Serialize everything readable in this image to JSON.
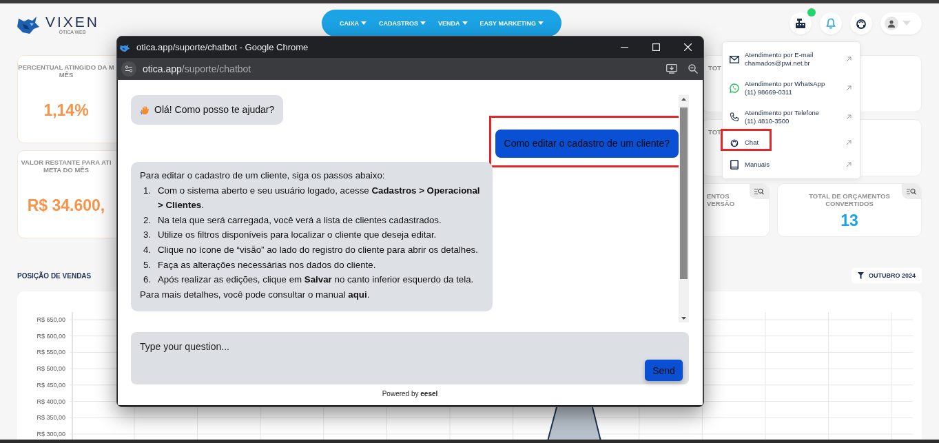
{
  "logo": {
    "name": "VIXEN",
    "subtitle": "ÓTICA WEB"
  },
  "nav": [
    {
      "label": "CAIXA"
    },
    {
      "label": "CADASTROS"
    },
    {
      "label": "VENDA"
    },
    {
      "label": "EASY MARKETING"
    }
  ],
  "header_buttons": [
    {
      "kind": "cash-register",
      "notification": true
    },
    {
      "kind": "bell",
      "notification": false
    },
    {
      "kind": "headset",
      "notification": false
    },
    {
      "kind": "user",
      "notification": false
    }
  ],
  "stat_cards_left": [
    {
      "label_lines": [
        "PERCENTUAL ATINGIDO DA M",
        "MÊS"
      ],
      "value": "1,14%",
      "color": "#f7944a"
    },
    {
      "label_lines": [
        "VALOR RESTANTE PARA ATI",
        "META DO MÊS"
      ],
      "value": "R$ 34.600,",
      "color": "#f7944a"
    }
  ],
  "stat_cards_right": [
    {
      "label_lines": [
        "TOT"
      ]
    },
    {
      "label_lines": [
        "TOT"
      ]
    },
    {
      "label_lines": [
        "ENTOS",
        "VERSÃO"
      ],
      "details_button": true
    },
    {
      "label_lines": [
        "TOTAL DE ORÇAMENTOS",
        "CONVERTIDOS"
      ],
      "value": "13",
      "color": "#1ba3e6",
      "details_button": true
    }
  ],
  "sales_section": {
    "title": "POSIÇÃO DE VENDAS",
    "filter": "OUTUBRO 2024"
  },
  "sales_chart": {
    "y_labels": [
      "R$ 650,00",
      "R$ 600,00",
      "R$ 550,00",
      "R$ 500,00",
      "R$ 450,00",
      "R$ 400,00",
      "R$ 350,00",
      "R$ 300,00"
    ]
  },
  "browser_window": {
    "title": "otica.app/suporte/chatbot - Google Chrome",
    "url_domain": "otica.app",
    "url_path": "/suporte/chatbot"
  },
  "chat": {
    "messages": [
      {
        "kind": "greeting",
        "text": "Olá! Como posso te ajudar?",
        "highlighted": false
      },
      {
        "kind": "text",
        "text": "Como editar o cadastro de um cliente?",
        "highlighted": true
      },
      {
        "kind": "steps",
        "intro": "Para editar o cadastro de um cliente, siga os passos abaixo:",
        "steps": [
          {
            "number": "1.",
            "text": "Com o sistema aberto e seu usuário logado, acesse **Cadastros > Operacional > Clientes**."
          },
          {
            "number": "2.",
            "text": "Na tela que será carregada, você verá a lista de clientes cadastrados."
          },
          {
            "number": "3.",
            "text": "Utilize os filtros disponíveis para localizar o cliente que deseja editar."
          },
          {
            "number": "4.",
            "text": "Clique no ícone de “visão” ao lado do registro do cliente para abrir os detalhes."
          },
          {
            "number": "5.",
            "text": "Faça as alterações necessárias nos dados do cliente."
          },
          {
            "number": "6.",
            "text": "Após realizar as edições, clique em **Salvar** no canto inferior esquerdo da tela."
          }
        ],
        "outro": "Para mais detalhes, você pode consultar o manual",
        "outro_link": "aqui",
        "outro_end": ".",
        "highlighted": false
      }
    ],
    "input": {
      "placeholder": "Type your question...",
      "button": "Send"
    },
    "powered_by": "Powered by **eesel**"
  },
  "support_menu": {
    "items": [
      {
        "kind": "email",
        "title": "Atendimento por E-mail",
        "detail": "chamados@pwi.net.br",
        "highlighted": false
      },
      {
        "kind": "whatsapp",
        "title": "Atendimento por WhatsApp",
        "detail": "(11) 98669-0311",
        "highlighted": false
      },
      {
        "kind": "phone",
        "title": "Atendimento por Telefone",
        "detail": "(11) 4810-3500",
        "highlighted": false
      },
      {
        "kind": "chat",
        "title": "Chat",
        "highlighted": true
      },
      {
        "kind": "manual",
        "title": "Manuais",
        "highlighted": false
      }
    ]
  }
}
